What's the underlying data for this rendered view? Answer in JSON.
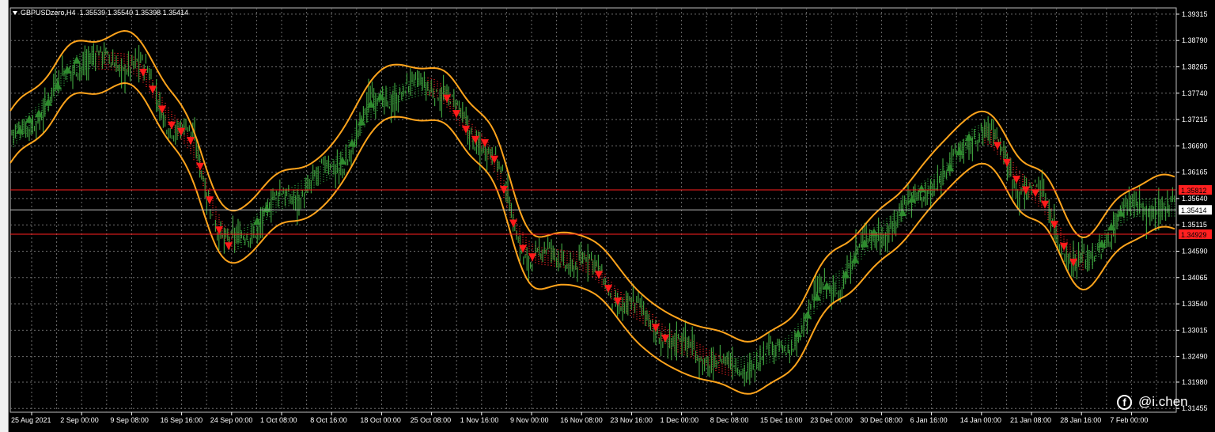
{
  "header": {
    "symbol": "GBPUSDzero,H4",
    "ohlc": "1.35539 1.35540 1.35398 1.35414"
  },
  "watermark": {
    "handle": "@i.chen",
    "icon": "facebook-icon"
  },
  "chart_data": {
    "type": "candlestick",
    "title": "GBPUSDzero,H4",
    "y_ticks": [
      "1.39315",
      "1.38790",
      "1.38265",
      "1.37740",
      "1.37215",
      "1.36690",
      "1.36165",
      "1.35640",
      "1.35115",
      "1.34590",
      "1.34065",
      "1.33540",
      "1.33015",
      "1.32490",
      "1.31980",
      "1.31455"
    ],
    "ylim": [
      1.3138,
      1.3944
    ],
    "x_ticks": [
      "25 Aug 2021",
      "2 Sep 00:00",
      "9 Sep 08:00",
      "16 Sep 16:00",
      "24 Sep 00:00",
      "1 Oct 08:00",
      "8 Oct 16:00",
      "18 Oct 00:00",
      "25 Oct 08:00",
      "1 Nov 16:00",
      "9 Nov 00:00",
      "16 Nov 08:00",
      "23 Nov 16:00",
      "1 Dec 00:00",
      "8 Dec 08:00",
      "15 Dec 16:00",
      "23 Dec 00:00",
      "30 Dec 08:00",
      "6 Jan 16:00",
      "14 Jan 00:00",
      "21 Jan 08:00",
      "28 Jan 16:00",
      "7 Feb 00:00"
    ],
    "price_path": [
      [
        "25 Aug 2021",
        1.3725
      ],
      [
        "2 Sep 00:00",
        1.384
      ],
      [
        "9 Sep 08:00",
        1.3835
      ],
      [
        "16 Sep 16:00",
        1.37
      ],
      [
        "24 Sep 00:00",
        1.347
      ],
      [
        "1 Oct 08:00",
        1.356
      ],
      [
        "8 Oct 16:00",
        1.362
      ],
      [
        "18 Oct 00:00",
        1.3765
      ],
      [
        "25 Oct 08:00",
        1.379
      ],
      [
        "1 Nov 16:00",
        1.368
      ],
      [
        "9 Nov 00:00",
        1.345
      ],
      [
        "16 Nov 08:00",
        1.344
      ],
      [
        "23 Nov 16:00",
        1.3345
      ],
      [
        "1 Dec 00:00",
        1.327
      ],
      [
        "8 Dec 08:00",
        1.3225
      ],
      [
        "15 Dec 16:00",
        1.326
      ],
      [
        "23 Dec 00:00",
        1.339
      ],
      [
        "30 Dec 08:00",
        1.35
      ],
      [
        "6 Jan 16:00",
        1.359
      ],
      [
        "14 Jan 00:00",
        1.37
      ],
      [
        "21 Jan 08:00",
        1.358
      ],
      [
        "28 Jan 16:00",
        1.343
      ],
      [
        "7 Feb 00:00",
        1.3545
      ]
    ],
    "horizontal_lines": [
      {
        "price": "1.35812",
        "color": "#ff2020",
        "label_bg": "#ff2020"
      },
      {
        "price": "1.35414",
        "color": "#c0c0c0",
        "label_bg": "#ffffff"
      },
      {
        "price": "1.34929",
        "color": "#ff2020",
        "label_bg": "#ff2020"
      }
    ],
    "series": [
      {
        "kind": "candles",
        "color": "#3c9c3c"
      },
      {
        "kind": "envelope-upper",
        "color": "#ffa41c"
      },
      {
        "kind": "envelope-lower",
        "color": "#ffa41c"
      },
      {
        "kind": "sell-arrows",
        "color": "#ff1a1a"
      },
      {
        "kind": "buy-arrows",
        "color": "#2e8b2e"
      }
    ],
    "colors": {
      "background": "#000000",
      "grid": "#6e6e6e",
      "axis_text": "#ffffff"
    },
    "grid": true
  }
}
